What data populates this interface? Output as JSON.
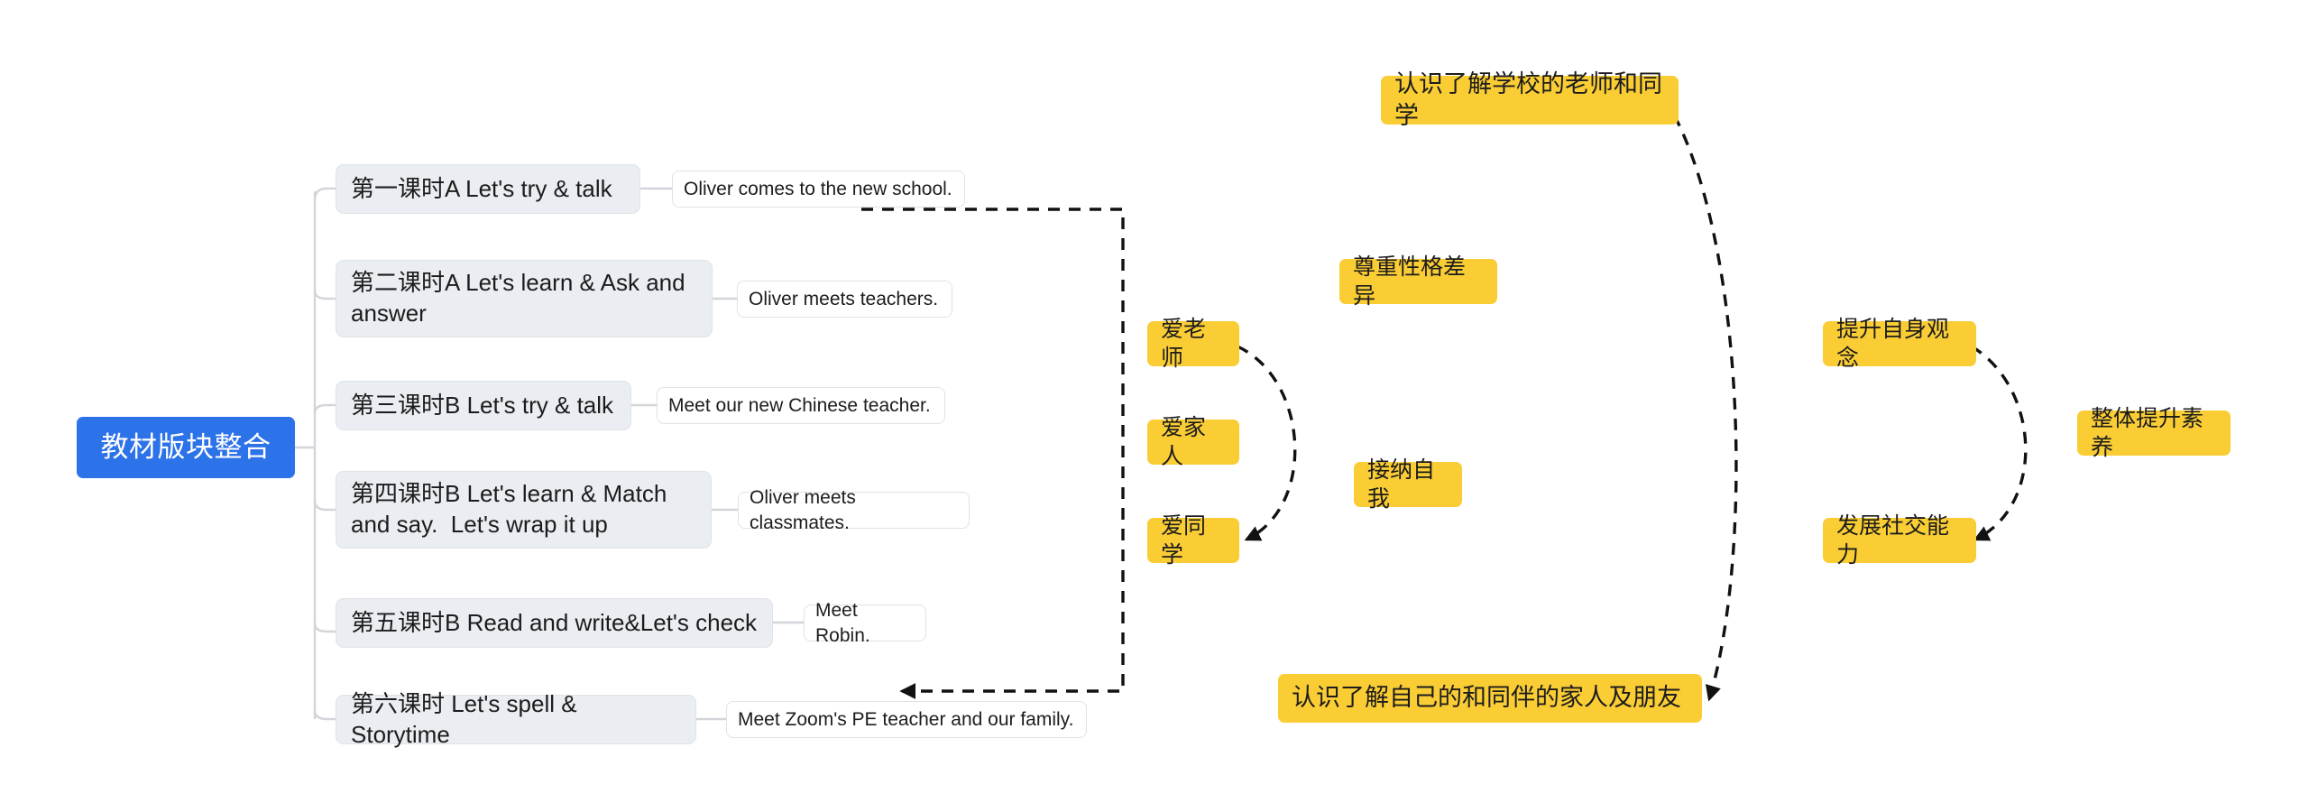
{
  "diagram": {
    "type": "mindmap",
    "title_node": {
      "label": "教材版块整合"
    },
    "colors": {
      "root_fill": "#2c72e8",
      "root_text": "#ffffff",
      "branch_fill": "#eaedf1",
      "leaf_fill": "#ffffff",
      "goal_fill": "#facd35",
      "link_line": "#d2d5d9",
      "dashed_line": "#1a1a1a"
    },
    "branches": [
      {
        "label": "第一课时A Let's try & talk",
        "detail": "Oliver comes to the new school."
      },
      {
        "label": "第二课时A Let's learn & Ask and answer",
        "detail": "Oliver meets teachers."
      },
      {
        "label": "第三课时B Let's try & talk",
        "detail": "Meet our new Chinese teacher."
      },
      {
        "label": "第四课时B Let's learn & Match and say.  Let's wrap it up",
        "detail": "Oliver meets classmates."
      },
      {
        "label": "第五课时B Read and write&Let's check",
        "detail": "Meet Robin."
      },
      {
        "label": "第六课时 Let's spell & Storytime",
        "detail": "Meet Zoom's PE teacher and our family."
      }
    ],
    "goals": [
      {
        "id": "g1",
        "label": "认识了解学校的老师和同学"
      },
      {
        "id": "g2",
        "label": "尊重性格差异"
      },
      {
        "id": "g3",
        "label": "爱老师"
      },
      {
        "id": "g4",
        "label": "爱家人"
      },
      {
        "id": "g5",
        "label": "爱同学"
      },
      {
        "id": "g6",
        "label": "接纳自我"
      },
      {
        "id": "g7",
        "label": "认识了解自己的和同伴的家人及朋友"
      },
      {
        "id": "g8",
        "label": "提升自身观念"
      },
      {
        "id": "g9",
        "label": "发展社交能力"
      },
      {
        "id": "g10",
        "label": "整体提升素养"
      }
    ],
    "annotations": {
      "dashed_arrows": [
        {
          "from": "Oliver comes to the new school.",
          "to": "Meet Zoom's PE teacher and our family."
        },
        {
          "from": "爱老师",
          "to": "爱同学"
        },
        {
          "from": "认识了解学校的老师和同学",
          "to": "认识了解自己的和同伴的家人及朋友"
        },
        {
          "from": "提升自身观念",
          "to": "发展社交能力"
        }
      ]
    }
  }
}
